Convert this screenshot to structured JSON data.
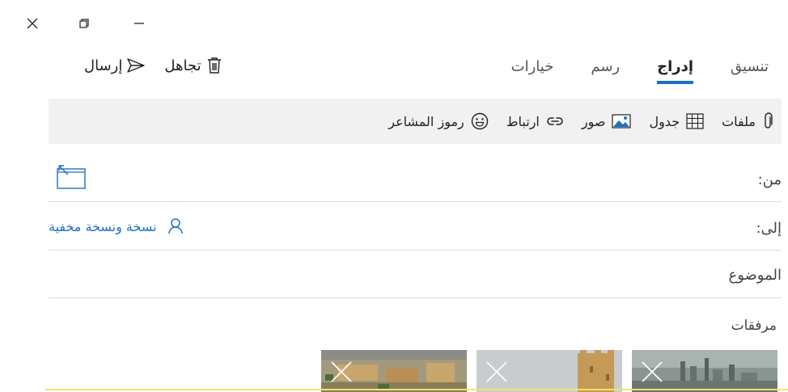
{
  "window_controls": {
    "close": "close",
    "restore": "restore",
    "minimize": "minimize"
  },
  "tabs": [
    {
      "label": "تنسيق",
      "active": false
    },
    {
      "label": "إدراج",
      "active": true
    },
    {
      "label": "رسم",
      "active": false
    },
    {
      "label": "خيارات",
      "active": false
    }
  ],
  "actions": {
    "discard_label": "تجاهل",
    "send_label": "إرسال"
  },
  "toolbar": {
    "files": "ملفات",
    "table": "جدول",
    "pictures": "صور",
    "link": "ارتباط",
    "emoji": "رموز المشاعر"
  },
  "from": {
    "label": "من:"
  },
  "to": {
    "label": "إلى:",
    "cc_bcc": "نسخة ونسخة مخفية"
  },
  "subject": {
    "placeholder": "الموضوع",
    "value": ""
  },
  "attachments": {
    "label": "مرفقات",
    "count": 3
  },
  "colors": {
    "accent": "#1e6fc2",
    "toolbar_bg": "#f1f1f1",
    "divider": "#dcdcdc",
    "focus": "#f3e36a"
  },
  "icons": [
    "close-icon",
    "restore-icon",
    "minimize-icon",
    "trash-icon",
    "send-icon",
    "paperclip-icon",
    "table-icon",
    "picture-icon",
    "link-icon",
    "emoji-icon",
    "from-account-icon",
    "person-icon",
    "remove-attachment-icon"
  ]
}
